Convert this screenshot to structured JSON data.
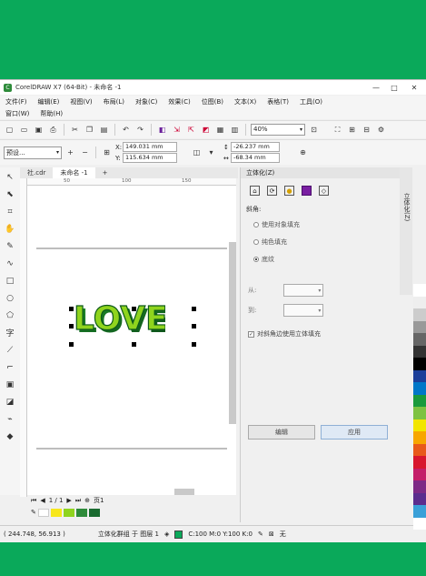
{
  "window": {
    "title": "CorelDRAW X7 (64-Bit) - 未命名 -1",
    "controls": [
      "—",
      "□",
      "✕"
    ]
  },
  "menu": {
    "row1": [
      "文件(F)",
      "编辑(E)",
      "视图(V)",
      "布局(L)",
      "对象(C)",
      "效果(C)",
      "位图(B)",
      "文本(X)",
      "表格(T)",
      "工具(O)"
    ],
    "row2": [
      "窗口(W)",
      "帮助(H)"
    ]
  },
  "toolbar": {
    "zoom": "40%"
  },
  "property_bar": {
    "preset": "预设...",
    "x": "149.031 mm",
    "y": "115.634 mm",
    "depth_x": "-26.237 mm",
    "depth_y": "-68.34 mm",
    "x_label": "X:",
    "y_label": "Y:"
  },
  "tabs": [
    {
      "label": "社.cdr"
    },
    {
      "label": "未命名 -1"
    }
  ],
  "ruler": {
    "h_ticks": [
      "50",
      "100",
      "150"
    ]
  },
  "canvas": {
    "art_text": "LOVE",
    "art_colors": {
      "front": "#8fd41e",
      "side": "#1f8a2c",
      "outline": "#0e5a1a"
    }
  },
  "docker": {
    "title": "立体化(Z)",
    "section_bevel": "斜角:",
    "radio_options": [
      {
        "label": "使用对象填充",
        "selected": false
      },
      {
        "label": "纯色填充",
        "selected": false
      },
      {
        "label": "底纹",
        "selected": true
      }
    ],
    "from_label": "从:",
    "to_label": "到:",
    "checkbox_label": "对斜角边使用立体填充",
    "btn_edit": "编辑",
    "btn_apply": "应用"
  },
  "side_tab": {
    "label": "立体化(Z)"
  },
  "page_nav": {
    "page": "1 / 1",
    "page_name": "页1"
  },
  "status": {
    "coords": "( 244.748, 56.913 )",
    "info": "立体化群组 于 图层 1",
    "fill": "C:100 M:0 Y:100 K:0",
    "outline": "无"
  },
  "palette": [
    "#ffffff",
    "#eeeeee",
    "#cccccc",
    "#999999",
    "#666666",
    "#333333",
    "#000000",
    "#1c3f9a",
    "#0077c8",
    "#1a9a3c",
    "#7ec242",
    "#f2e500",
    "#f7a600",
    "#e8591a",
    "#d8162e",
    "#c41e69",
    "#7d2a86",
    "#5b2d8e",
    "#3aa0d8",
    "#ffffff"
  ]
}
